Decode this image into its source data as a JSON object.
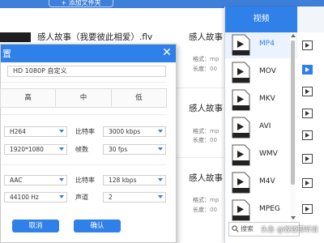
{
  "toolbar": {
    "add_folder_label": "+ 添加文件夹"
  },
  "file_list": [
    {
      "filename": "感人故事（我要彼此相爱）.flv",
      "output_name": "感人故事（",
      "format_label": "格式：",
      "format_value": "mp",
      "duration_label": "长度：",
      "duration_value": "00"
    },
    {
      "filename": "",
      "output_name": "感人故事",
      "format_label": "格式：",
      "format_value": "mp",
      "duration_label": "长度：",
      "duration_value": "00"
    },
    {
      "filename": "",
      "output_name": "感人故事",
      "format_label": "格式：",
      "format_value": "mp",
      "duration_label": "长度：",
      "duration_value": "00"
    }
  ],
  "dialog": {
    "title": "置",
    "preset_value": "HD 1080P 自定义",
    "quality_options": [
      "高",
      "中",
      "低"
    ],
    "video": {
      "encoder": "H264",
      "bitrate_label": "比特率",
      "bitrate": "3000 kbps",
      "resolution": "1920*1080",
      "framerate_label": "帧数",
      "framerate": "30 fps"
    },
    "audio": {
      "encoder": "AAC",
      "bitrate_label": "比特率",
      "bitrate": "128 kbps",
      "samplerate": "44100 Hz",
      "channels_label": "声道",
      "channels": "2"
    },
    "cancel_label": "取消",
    "ok_label": "确认"
  },
  "format_panel": {
    "tab_label": "视频",
    "formats": [
      {
        "name": "MP4",
        "selected": true,
        "icon": "mp4-file-icon"
      },
      {
        "name": "MOV",
        "selected": false,
        "icon": "mov-file-icon"
      },
      {
        "name": "MKV",
        "selected": false,
        "icon": "mkv-file-icon"
      },
      {
        "name": "AVI",
        "selected": false,
        "icon": "avi-file-icon"
      },
      {
        "name": "WMV",
        "selected": false,
        "icon": "wmv-file-icon"
      },
      {
        "name": "M4V",
        "selected": false,
        "icon": "m4v-file-icon"
      },
      {
        "name": "MPEG",
        "selected": false,
        "icon": "mpeg-file-icon"
      }
    ],
    "search_placeholder": "搜索"
  },
  "watermark": "头条 @蛟蛟眼听说",
  "colors": {
    "accent": "#2f80e8",
    "selected_bg": "#eaf3ff"
  }
}
